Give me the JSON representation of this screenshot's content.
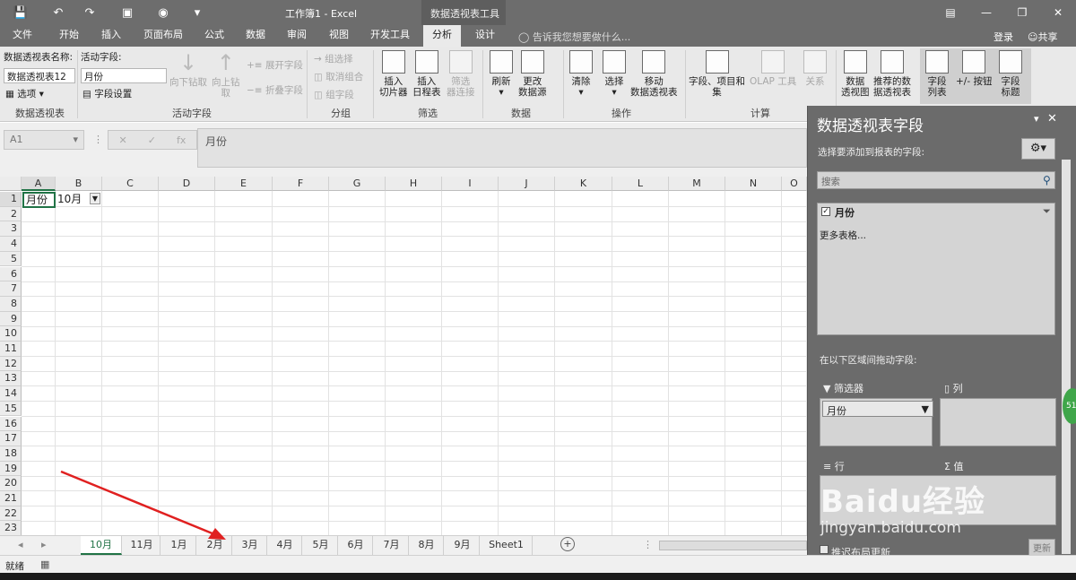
{
  "titlebar": {
    "doc_title": "工作簿1 - Excel",
    "context_tools": "数据透视表工具",
    "icons": [
      "save-icon",
      "undo-icon",
      "redo-icon",
      "table-icon",
      "camera-icon",
      "customize-icon",
      "ribbon-display-icon",
      "minimize-icon",
      "restore-icon",
      "close-icon"
    ]
  },
  "tabs": [
    "文件",
    "开始",
    "插入",
    "页面布局",
    "公式",
    "数据",
    "审阅",
    "视图",
    "开发工具",
    "分析",
    "设计"
  ],
  "active_tab": "分析",
  "tell_me": "告诉我您想要做什么...",
  "login": "登录",
  "share": "共享",
  "ribbon": {
    "pivot_name_label": "数据透视表名称:",
    "pivot_name_value": "数据透视表12",
    "options": "选项",
    "group_pivot": "数据透视表",
    "active_field_label": "活动字段:",
    "active_field_value": "月份",
    "field_settings": "字段设置",
    "drill_down": "向下钻取",
    "drill_up": "向上钻",
    "drill_up2": "取",
    "expand_field": "展开字段",
    "collapse_field": "折叠字段",
    "group_active_field": "活动字段",
    "group_selection": "组选择",
    "ungroup": "取消组合",
    "group_field": "组字段",
    "group_group": "分组",
    "insert_slicer": [
      "插入",
      "切片器"
    ],
    "insert_timeline": [
      "插入",
      "日程表"
    ],
    "filter_conn": [
      "筛选",
      "器连接"
    ],
    "group_filter": "筛选",
    "refresh": "刷新",
    "change_source": [
      "更改",
      "数据源"
    ],
    "group_data": "数据",
    "clear": "清除",
    "select": "选择",
    "move_pivot": [
      "移动",
      "数据透视表"
    ],
    "group_actions": "操作",
    "fields_items": [
      "字段、项目和",
      "集"
    ],
    "olap": "OLAP 工具",
    "relations": "关系",
    "group_calc": "计算",
    "pivot_chart": [
      "数据",
      "透视图"
    ],
    "recommended": [
      "推荐的数",
      "据透视表"
    ],
    "field_list": [
      "字段",
      "列表"
    ],
    "plus_minus": "+/- 按钮",
    "field_headers": [
      "字段",
      "标题"
    ]
  },
  "formula_bar": {
    "name_box": "A1",
    "content": "月份",
    "fx": "fx"
  },
  "grid": {
    "columns": [
      "A",
      "B",
      "C",
      "D",
      "E",
      "F",
      "G",
      "H",
      "I",
      "J",
      "K",
      "L",
      "M",
      "N",
      "O"
    ],
    "rows": [
      "1",
      "2",
      "3",
      "4",
      "5",
      "6",
      "7",
      "8",
      "9",
      "10",
      "11",
      "12",
      "13",
      "14",
      "15",
      "16",
      "17",
      "18",
      "19",
      "20",
      "21",
      "22",
      "23"
    ],
    "a1": "月份",
    "b1": "10月"
  },
  "sheets": [
    "10月",
    "11月",
    "1月",
    "2月",
    "3月",
    "4月",
    "5月",
    "6月",
    "7月",
    "8月",
    "9月",
    "Sheet1"
  ],
  "active_sheet": "10月",
  "status": "就绪",
  "panel": {
    "title": "数据透视表字段",
    "subtitle": "选择要添加到报表的字段:",
    "search_placeholder": "搜索",
    "field": "月份",
    "more_tables": "更多表格...",
    "drag_hint": "在以下区域间拖动字段:",
    "filters": "筛选器",
    "columns": "列",
    "rows": "行",
    "values": "值",
    "filter_chip": "月份",
    "defer": "推迟布局更新",
    "update": "更新"
  },
  "badge": "51",
  "watermark": {
    "brand": "Baidu经验",
    "url": "jingyan.baidu.com"
  },
  "colors": {
    "accent_green": "#217346",
    "title_gray": "#6d6d6d",
    "arrow_red": "#e02020"
  }
}
